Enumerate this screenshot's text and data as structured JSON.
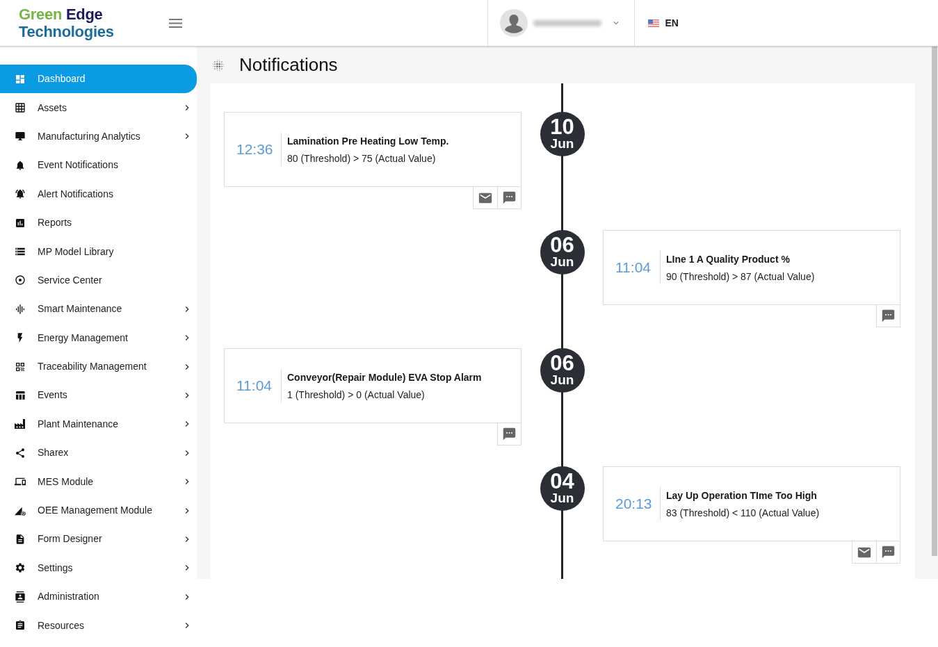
{
  "header": {
    "logo": {
      "line_1": [
        "Green",
        "Edge"
      ],
      "line_2": "Technologies"
    },
    "language": {
      "code": "EN"
    }
  },
  "sidebar": {
    "items": [
      {
        "label": "Dashboard",
        "selected": true,
        "expandable": false
      },
      {
        "label": "Assets",
        "selected": false,
        "expandable": true
      },
      {
        "label": "Manufacturing Analytics",
        "selected": false,
        "expandable": true
      },
      {
        "label": "Event Notifications",
        "selected": false,
        "expandable": false
      },
      {
        "label": "Alert Notifications",
        "selected": false,
        "expandable": false
      },
      {
        "label": "Reports",
        "selected": false,
        "expandable": false
      },
      {
        "label": "MP Model Library",
        "selected": false,
        "expandable": false
      },
      {
        "label": "Service Center",
        "selected": false,
        "expandable": false
      },
      {
        "label": "Smart Maintenance",
        "selected": false,
        "expandable": true
      },
      {
        "label": "Energy Management",
        "selected": false,
        "expandable": true
      },
      {
        "label": "Traceability Management",
        "selected": false,
        "expandable": true
      },
      {
        "label": "Events",
        "selected": false,
        "expandable": true
      },
      {
        "label": "Plant Maintenance",
        "selected": false,
        "expandable": true
      },
      {
        "label": "Sharex",
        "selected": false,
        "expandable": true
      },
      {
        "label": "MES Module",
        "selected": false,
        "expandable": true
      },
      {
        "label": "OEE Management Module",
        "selected": false,
        "expandable": true
      },
      {
        "label": "Form Designer",
        "selected": false,
        "expandable": true
      },
      {
        "label": "Settings",
        "selected": false,
        "expandable": true
      },
      {
        "label": "Administration",
        "selected": false,
        "expandable": true
      },
      {
        "label": "Resources",
        "selected": false,
        "expandable": true
      }
    ]
  },
  "page": {
    "title": "Notifications"
  },
  "timeline": {
    "entries": [
      {
        "day": "10",
        "month": "Jun",
        "time": "12:36",
        "title": "Lamination Pre Heating Low Temp.",
        "detail": "80 (Threshold) > 75 (Actual Value)",
        "actions": [
          {
            "kind": "email"
          },
          {
            "kind": "comment"
          }
        ]
      },
      {
        "day": "06",
        "month": "Jun",
        "time": "11:04",
        "title": "LIne 1 A Quality Product %",
        "detail": "90 (Threshold) > 87 (Actual Value)",
        "actions": [
          {
            "kind": "comment"
          }
        ]
      },
      {
        "day": "06",
        "month": "Jun",
        "time": "11:04",
        "title": "Conveyor(Repair Module) EVA Stop Alarm",
        "detail": "1 (Threshold) > 0 (Actual Value)",
        "actions": [
          {
            "kind": "comment"
          }
        ]
      },
      {
        "day": "04",
        "month": "Jun",
        "time": "20:13",
        "title": "Lay Up Operation TIme Too High",
        "detail": "83 (Threshold) < 110 (Actual Value)",
        "actions": [
          {
            "kind": "email"
          },
          {
            "kind": "comment"
          }
        ]
      }
    ]
  }
}
